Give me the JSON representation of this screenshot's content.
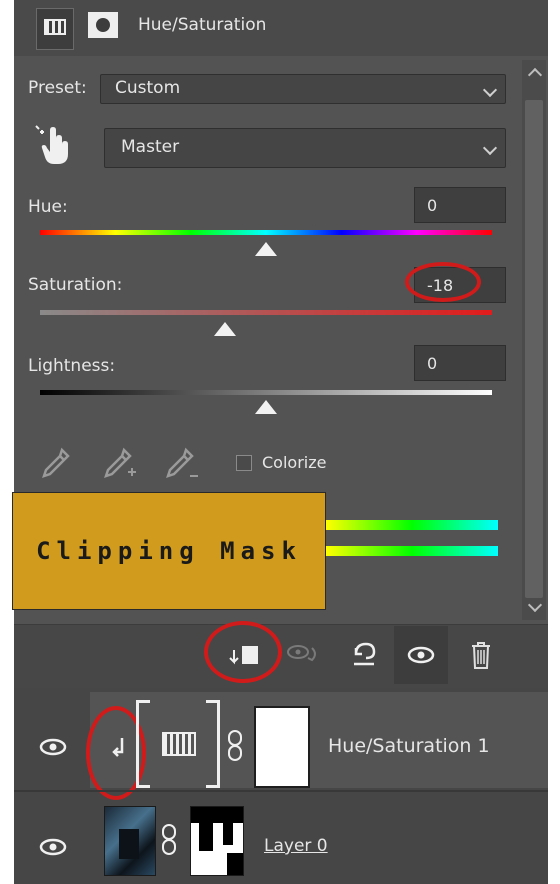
{
  "panel": {
    "title": "Hue/Saturation"
  },
  "preset": {
    "label": "Preset:",
    "value": "Custom"
  },
  "channel": {
    "value": "Master"
  },
  "hue": {
    "label": "Hue:",
    "value": "0",
    "level": 0.5
  },
  "saturation": {
    "label": "Saturation:",
    "value": "-18",
    "level": 0.41
  },
  "lightness": {
    "label": "Lightness:",
    "value": "0",
    "level": 0.5
  },
  "colorize": {
    "label": "Colorize",
    "checked": false
  },
  "overlay": {
    "text": "Clipping Mask",
    "color": "#d19c1d"
  },
  "layers": [
    {
      "name": "Hue/Saturation 1",
      "visible": true,
      "clipped": true
    },
    {
      "name": "Layer 0",
      "visible": true,
      "clipped": false
    }
  ],
  "colors": {
    "highlight": "#d11b1b",
    "panel_bg": "#535353"
  }
}
